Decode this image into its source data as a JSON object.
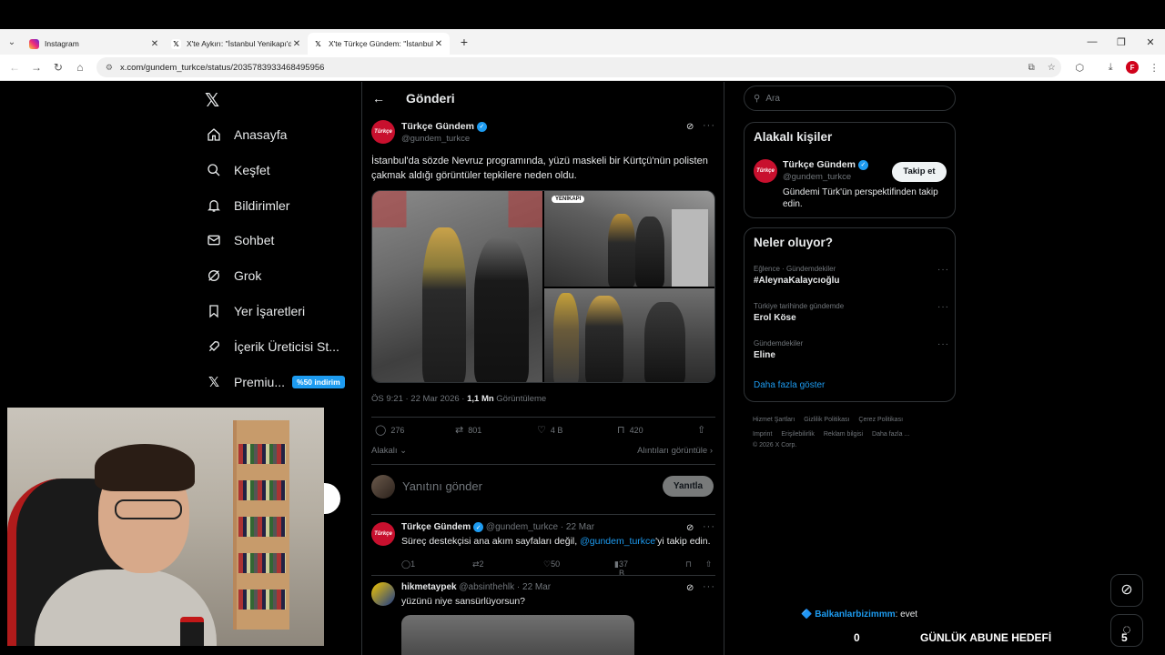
{
  "browser": {
    "tabs": [
      {
        "title": "Instagram",
        "active": false
      },
      {
        "title": "X'te Aykırı: \"İstanbul Yenikapı'da",
        "active": false
      },
      {
        "title": "X'te Türkçe Gündem: \"İstanbul",
        "active": true
      }
    ],
    "url": "x.com/gundem_turkce/status/2035783933468495956",
    "new_tab": "+"
  },
  "nav": {
    "items": [
      {
        "label": "Anasayfa",
        "icon": "home-icon"
      },
      {
        "label": "Keşfet",
        "icon": "search-icon"
      },
      {
        "label": "Bildirimler",
        "icon": "bell-icon"
      },
      {
        "label": "Sohbet",
        "icon": "mail-icon"
      },
      {
        "label": "Grok",
        "icon": "grok-icon"
      },
      {
        "label": "Yer İşaretleri",
        "icon": "bookmark-icon"
      },
      {
        "label": "İçerik Üreticisi St...",
        "icon": "rocket-icon"
      },
      {
        "label": "Premiu...",
        "icon": "x-icon"
      }
    ],
    "promo": "%50 indirim"
  },
  "header": {
    "title": "Gönderi"
  },
  "post": {
    "author": "Türkçe Gündem",
    "handle": "@gundem_turkce",
    "avatar_text": "Türkçe",
    "text": "İstanbul'da sözde Nevruz programında, yüzü maskeli bir Kürtçü'nün polisten çakmak aldığı görüntüler tepkilere neden oldu.",
    "media_badge": "YENİKAPI",
    "time": "ÖS 9:21 · 22 Mar 2026 ·",
    "views_count": "1,1 Mn",
    "views_label": "Görüntüleme",
    "stats": {
      "replies": "276",
      "reposts": "801",
      "likes": "4 B",
      "bookmarks": "420"
    },
    "sort": "Alakalı",
    "quotes_link": "Alıntıları görüntüle"
  },
  "reply_box": {
    "placeholder": "Yanıtını gönder",
    "button": "Yanıtla"
  },
  "replies": [
    {
      "author": "Türkçe Gündem",
      "handle": "@gundem_turkce",
      "date": "· 22 Mar",
      "text_pre": "Süreç destekçisi ana akım sayfaları değil,",
      "mention": "@gundem_turkce",
      "text_post": "'yi takip edin.",
      "stats": {
        "replies": "1",
        "reposts": "2",
        "likes": "50",
        "views": "37 B"
      }
    },
    {
      "author": "hikmetaypek",
      "handle": "@absinthehlk",
      "date": "· 22 Mar",
      "text": "yüzünü niye sansürlüyorsun?"
    }
  ],
  "right": {
    "search_placeholder": "Ara",
    "relevant_title": "Alakalı kişiler",
    "relevant_person": {
      "name": "Türkçe Gündem",
      "handle": "@gundem_turkce",
      "bio": "Gündemi Türk'ün perspektifinden takip edin.",
      "follow": "Takip et"
    },
    "trending_title": "Neler oluyor?",
    "trends": [
      {
        "category": "Eğlence · Gündemdekiler",
        "name": "#AleynaKalaycıoğlu"
      },
      {
        "category": "Türkiye tarihinde gündemde",
        "name": "Erol Köse"
      },
      {
        "category": "Gündemdekiler",
        "name": "Eline"
      }
    ],
    "show_more": "Daha fazla göster",
    "footer": [
      "Hizmet Şartları",
      "Gizlilik Politikası",
      "Çerez Politikası",
      "Imprint",
      "Erişilebilirlik",
      "Reklam bilgisi",
      "Daha fazla ...",
      "© 2026 X Corp."
    ]
  },
  "overlay": {
    "chat_user": "Balkanlarbizimmm",
    "chat_msg": ": evet",
    "sub_count": "0",
    "sub_label": "GÜNLÜK ABUNE HEDEFİ",
    "sub_goal": "5"
  },
  "colors": {
    "accent": "#1d9bf0",
    "background": "#000000",
    "border": "#2f3336",
    "muted": "#71767b",
    "avatar_red": "#c8102e"
  }
}
